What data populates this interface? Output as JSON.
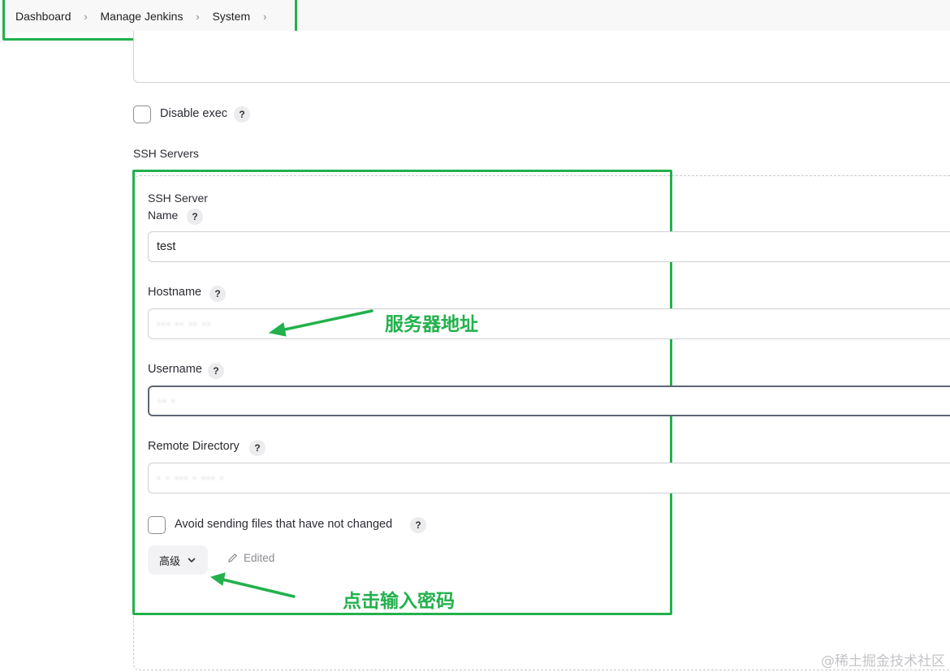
{
  "breadcrumb": {
    "items": [
      "Dashboard",
      "Manage Jenkins",
      "System"
    ],
    "separator": "›"
  },
  "disable_exec": {
    "label": "Disable exec",
    "checked": false,
    "help": "?"
  },
  "section_title": "SSH Servers",
  "ssh_server": {
    "heading": "SSH Server",
    "name_label": "Name",
    "name_value": "test",
    "hostname_label": "Hostname",
    "hostname_value": "··· ·· ·· ··",
    "username_label": "Username",
    "username_value": "·· ·",
    "remote_dir_label": "Remote Directory",
    "remote_dir_value": "· · ··· · ··· ·",
    "avoid_label": "Avoid sending files that have not changed",
    "avoid_checked": false,
    "help": "?"
  },
  "advanced_button": {
    "label": "高级",
    "icon": "chevron-down-icon"
  },
  "edited_label": {
    "label": "Edited",
    "icon": "pencil-icon"
  },
  "annotations": {
    "hostname_note": "服务器地址",
    "advanced_note": "点击输入密码"
  },
  "watermark": "@稀土掘金技术社区",
  "colors": {
    "annotation_green": "#22b14c",
    "border": "#d0d0d7",
    "topbar_bg": "#f8f8f9"
  }
}
